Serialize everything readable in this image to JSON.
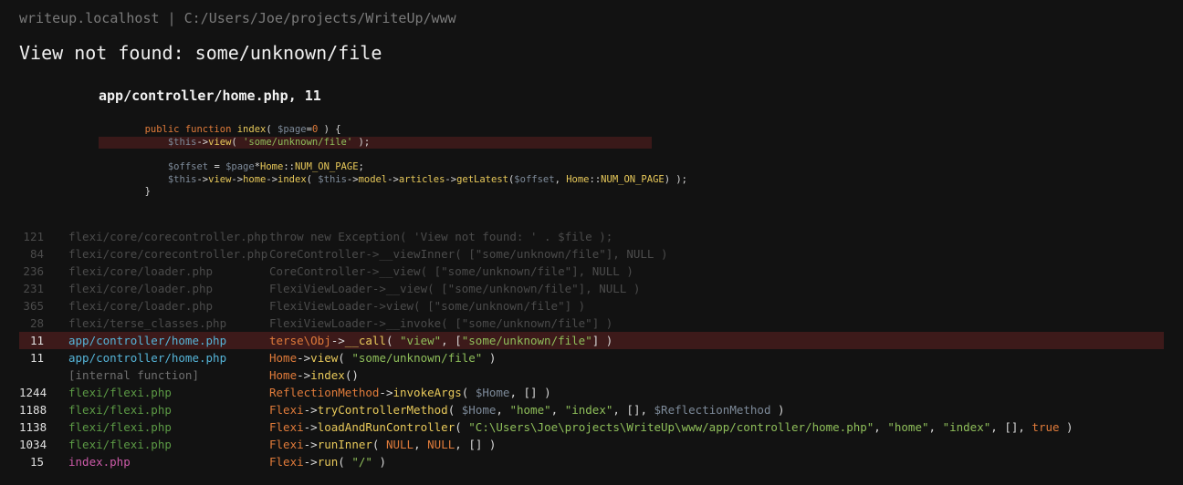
{
  "header": "writeup.localhost | C:/Users/Joe/projects/WriteUp/www",
  "error_title": "View not found: some/unknown/file",
  "source": {
    "location": "app/controller/home.php, 11",
    "lines": [
      {
        "highlight": false,
        "tokens": [
          [
            "p",
            "        "
          ],
          [
            "k",
            "public function "
          ],
          [
            "m",
            "index"
          ],
          [
            "p",
            "( "
          ],
          [
            "v",
            "$page"
          ],
          [
            "p",
            "="
          ],
          [
            "k",
            "0"
          ],
          [
            "p",
            " ) {"
          ]
        ]
      },
      {
        "highlight": true,
        "tokens": [
          [
            "p",
            "            "
          ],
          [
            "v",
            "$this"
          ],
          [
            "p",
            "->"
          ],
          [
            "m",
            "view"
          ],
          [
            "p",
            "( "
          ],
          [
            "s",
            "'some/unknown/file'"
          ],
          [
            "p",
            " );"
          ]
        ]
      },
      {
        "highlight": false,
        "tokens": [
          [
            "p",
            " "
          ]
        ]
      },
      {
        "highlight": false,
        "tokens": [
          [
            "p",
            "            "
          ],
          [
            "v",
            "$offset"
          ],
          [
            "p",
            " = "
          ],
          [
            "v",
            "$page"
          ],
          [
            "p",
            "*"
          ],
          [
            "m",
            "Home"
          ],
          [
            "p",
            "::"
          ],
          [
            "m",
            "NUM_ON_PAGE"
          ],
          [
            "p",
            ";"
          ]
        ]
      },
      {
        "highlight": false,
        "tokens": [
          [
            "p",
            "            "
          ],
          [
            "v",
            "$this"
          ],
          [
            "p",
            "->"
          ],
          [
            "m",
            "view"
          ],
          [
            "p",
            "->"
          ],
          [
            "m",
            "home"
          ],
          [
            "p",
            "->"
          ],
          [
            "m",
            "index"
          ],
          [
            "p",
            "( "
          ],
          [
            "v",
            "$this"
          ],
          [
            "p",
            "->"
          ],
          [
            "m",
            "model"
          ],
          [
            "p",
            "->"
          ],
          [
            "m",
            "articles"
          ],
          [
            "p",
            "->"
          ],
          [
            "m",
            "getLatest"
          ],
          [
            "p",
            "("
          ],
          [
            "v",
            "$offset"
          ],
          [
            "p",
            ", "
          ],
          [
            "m",
            "Home"
          ],
          [
            "p",
            "::"
          ],
          [
            "m",
            "NUM_ON_PAGE"
          ],
          [
            "p",
            ") );"
          ]
        ]
      },
      {
        "highlight": false,
        "tokens": [
          [
            "p",
            "        }"
          ]
        ]
      }
    ]
  },
  "trace": [
    {
      "line": "121",
      "file": "flexi/core/corecontroller.php",
      "ftype": "fn",
      "dim": true,
      "hl": false,
      "call": [
        [
          "p",
          "throw new Exception( 'View not found: ' . $file );"
        ]
      ]
    },
    {
      "line": "84",
      "file": "flexi/core/corecontroller.php",
      "ftype": "fn",
      "dim": true,
      "hl": false,
      "call": [
        [
          "p",
          "CoreController->__viewInner( [\"some/unknown/file\"], NULL )"
        ]
      ]
    },
    {
      "line": "236",
      "file": "flexi/core/loader.php",
      "ftype": "fn",
      "dim": true,
      "hl": false,
      "call": [
        [
          "p",
          "CoreController->__view( [\"some/unknown/file\"], NULL )"
        ]
      ]
    },
    {
      "line": "231",
      "file": "flexi/core/loader.php",
      "ftype": "fn",
      "dim": true,
      "hl": false,
      "call": [
        [
          "p",
          "FlexiViewLoader->__view( [\"some/unknown/file\"], NULL )"
        ]
      ]
    },
    {
      "line": "365",
      "file": "flexi/core/loader.php",
      "ftype": "fn",
      "dim": true,
      "hl": false,
      "call": [
        [
          "p",
          "FlexiViewLoader->view( [\"some/unknown/file\"] )"
        ]
      ]
    },
    {
      "line": "28",
      "file": "flexi/terse_classes.php",
      "ftype": "fn",
      "dim": true,
      "hl": false,
      "call": [
        [
          "p",
          "FlexiViewLoader->__invoke( [\"some/unknown/file\"] )"
        ]
      ]
    },
    {
      "line": "11",
      "file": "app/controller/home.php",
      "ftype": "fa",
      "dim": false,
      "hl": true,
      "call": [
        [
          "k",
          "terse\\Obj"
        ],
        [
          "p",
          "->"
        ],
        [
          "m",
          "__call"
        ],
        [
          "p",
          "( "
        ],
        [
          "s",
          "\"view\""
        ],
        [
          "p",
          ", ["
        ],
        [
          "s",
          "\"some/unknown/file\""
        ],
        [
          "p",
          "] )"
        ]
      ]
    },
    {
      "line": "11",
      "file": "app/controller/home.php",
      "ftype": "fa",
      "dim": false,
      "hl": false,
      "call": [
        [
          "k",
          "Home"
        ],
        [
          "p",
          "->"
        ],
        [
          "m",
          "view"
        ],
        [
          "p",
          "( "
        ],
        [
          "s",
          "\"some/unknown/file\""
        ],
        [
          "p",
          " )"
        ]
      ]
    },
    {
      "line": "",
      "file": "[internal function]",
      "ftype": "g",
      "dim": false,
      "hl": false,
      "call": [
        [
          "k",
          "Home"
        ],
        [
          "p",
          "->"
        ],
        [
          "m",
          "index"
        ],
        [
          "p",
          "()"
        ]
      ]
    },
    {
      "line": "1244",
      "file": "flexi/flexi.php",
      "ftype": "ff",
      "dim": false,
      "hl": false,
      "call": [
        [
          "k",
          "ReflectionMethod"
        ],
        [
          "p",
          "->"
        ],
        [
          "m",
          "invokeArgs"
        ],
        [
          "p",
          "( "
        ],
        [
          "v",
          "$Home"
        ],
        [
          "p",
          ", [] )"
        ]
      ]
    },
    {
      "line": "1188",
      "file": "flexi/flexi.php",
      "ftype": "ff",
      "dim": false,
      "hl": false,
      "call": [
        [
          "k",
          "Flexi"
        ],
        [
          "p",
          "->"
        ],
        [
          "m",
          "tryControllerMethod"
        ],
        [
          "p",
          "( "
        ],
        [
          "v",
          "$Home"
        ],
        [
          "p",
          ", "
        ],
        [
          "s",
          "\"home\""
        ],
        [
          "p",
          ", "
        ],
        [
          "s",
          "\"index\""
        ],
        [
          "p",
          ", [], "
        ],
        [
          "v",
          "$ReflectionMethod"
        ],
        [
          "p",
          " )"
        ]
      ]
    },
    {
      "line": "1138",
      "file": "flexi/flexi.php",
      "ftype": "ff",
      "dim": false,
      "hl": false,
      "call": [
        [
          "k",
          "Flexi"
        ],
        [
          "p",
          "->"
        ],
        [
          "m",
          "loadAndRunController"
        ],
        [
          "p",
          "( "
        ],
        [
          "s",
          "\"C:\\Users\\Joe\\projects\\WriteUp\\www/app/controller/home.php\""
        ],
        [
          "p",
          ", "
        ],
        [
          "s",
          "\"home\""
        ],
        [
          "p",
          ", "
        ],
        [
          "s",
          "\"index\""
        ],
        [
          "p",
          ", [], "
        ],
        [
          "k",
          "true"
        ],
        [
          "p",
          " )"
        ]
      ]
    },
    {
      "line": "1034",
      "file": "flexi/flexi.php",
      "ftype": "ff",
      "dim": false,
      "hl": false,
      "call": [
        [
          "k",
          "Flexi"
        ],
        [
          "p",
          "->"
        ],
        [
          "m",
          "runInner"
        ],
        [
          "p",
          "( "
        ],
        [
          "k",
          "NULL"
        ],
        [
          "p",
          ", "
        ],
        [
          "k",
          "NULL"
        ],
        [
          "p",
          ", [] )"
        ]
      ]
    },
    {
      "line": "15",
      "file": "index.php",
      "ftype": "fi",
      "dim": false,
      "hl": false,
      "call": [
        [
          "k",
          "Flexi"
        ],
        [
          "p",
          "->"
        ],
        [
          "m",
          "run"
        ],
        [
          "p",
          "( "
        ],
        [
          "s",
          "\"/\""
        ],
        [
          "p",
          " )"
        ]
      ]
    }
  ]
}
